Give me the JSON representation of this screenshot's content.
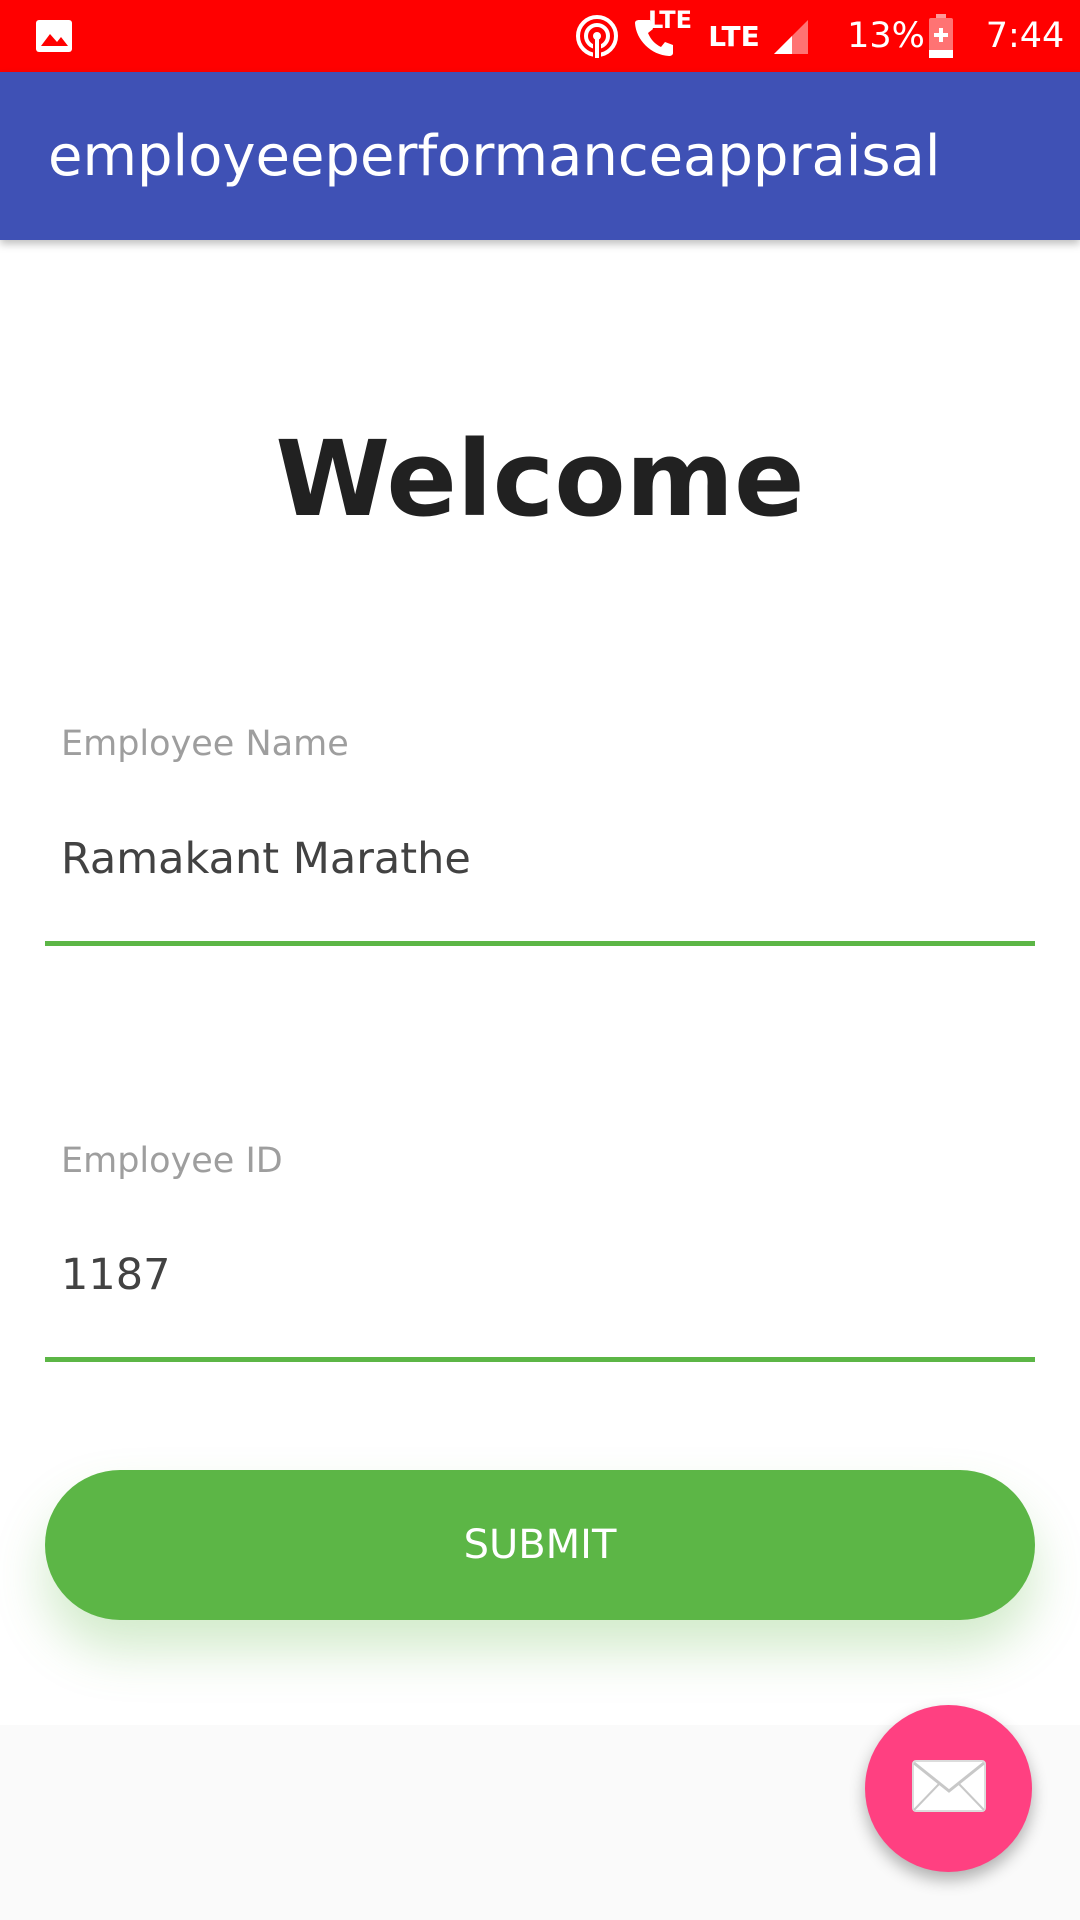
{
  "status_bar": {
    "notification_icon": "image-icon",
    "hotspot_icon": "hotspot-icon",
    "call_icon": "volte-call-icon",
    "call_lte_label": "LTE",
    "network_label": "LTE",
    "signal_icon": "signal-icon",
    "battery_percent": "13%",
    "battery_icon": "battery-charging-icon",
    "time": "7:44"
  },
  "app_bar": {
    "title": "employeeperformanceappraisal"
  },
  "main": {
    "heading": "Welcome",
    "fields": [
      {
        "label": "Employee Name",
        "value": "Ramakant Marathe"
      },
      {
        "label": "Employee ID",
        "value": "1187"
      }
    ],
    "submit_label": "SUBMIT"
  },
  "fab": {
    "icon": "mail-icon"
  },
  "colors": {
    "status_bar": "#ff0000",
    "app_bar": "#3f51b5",
    "accent_green": "#5cb646",
    "fab_pink": "#ff4081"
  }
}
